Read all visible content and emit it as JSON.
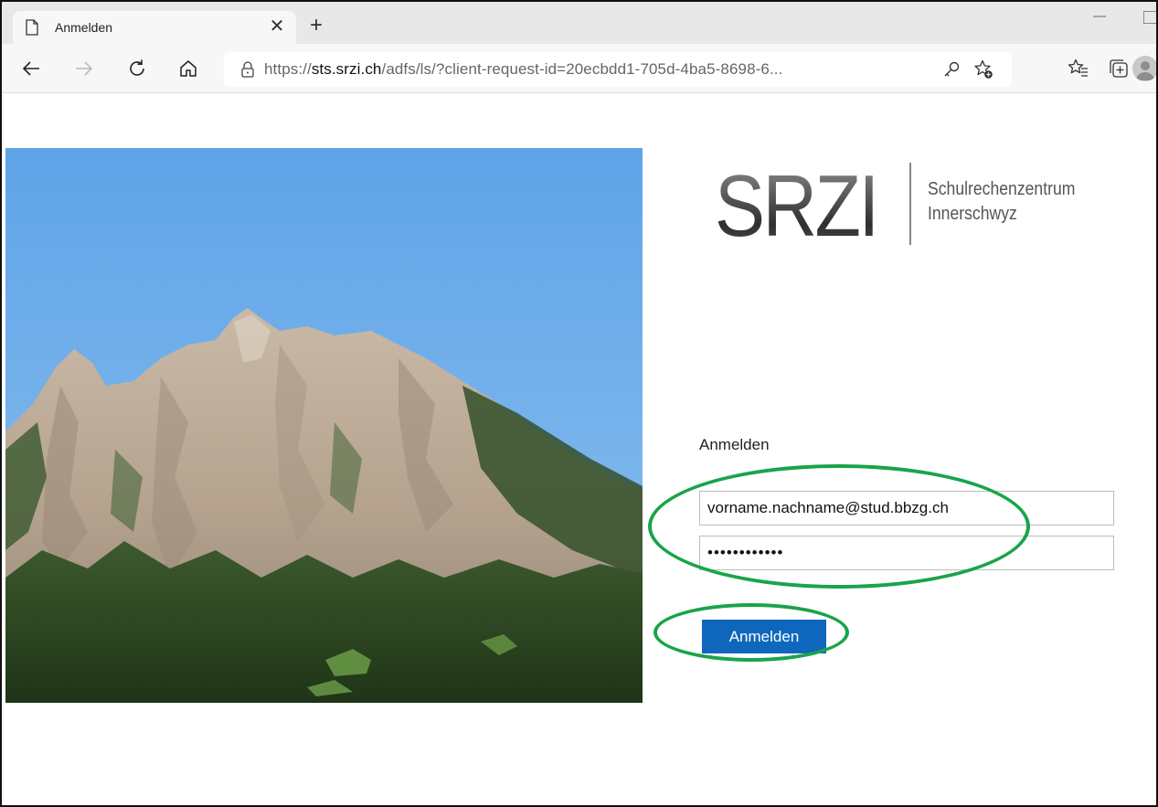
{
  "browser": {
    "tab": {
      "title": "Anmelden",
      "close_glyph": "✕",
      "icon": "page-icon"
    },
    "new_tab_glyph": "+",
    "toolbar": {
      "back_icon": "back-arrow-icon",
      "forward_icon": "forward-arrow-icon",
      "reload_icon": "reload-icon",
      "home_icon": "home-icon",
      "key_icon": "key-icon",
      "add_favorite_icon": "add-favorite-icon",
      "favorites_icon": "favorites-icon",
      "collections_icon": "collections-icon",
      "profile_icon": "profile-avatar-icon"
    },
    "address": {
      "scheme": "https://",
      "host": "sts.srzi.ch",
      "path": "/adfs/ls/?client-request-id=20ecbdd1-705d-4ba5-8698-6..."
    }
  },
  "page": {
    "brand": {
      "mark": "SRZI",
      "line1": "Schulrechenzentrum",
      "line2": "Innerschwyz"
    },
    "form": {
      "title": "Anmelden",
      "username_value": "vorname.nachname@stud.bbzg.ch",
      "password_value": "••••••••••••",
      "submit_label": "Anmelden"
    },
    "annotation_color": "#19a44a",
    "button_color": "#0f67bd"
  }
}
